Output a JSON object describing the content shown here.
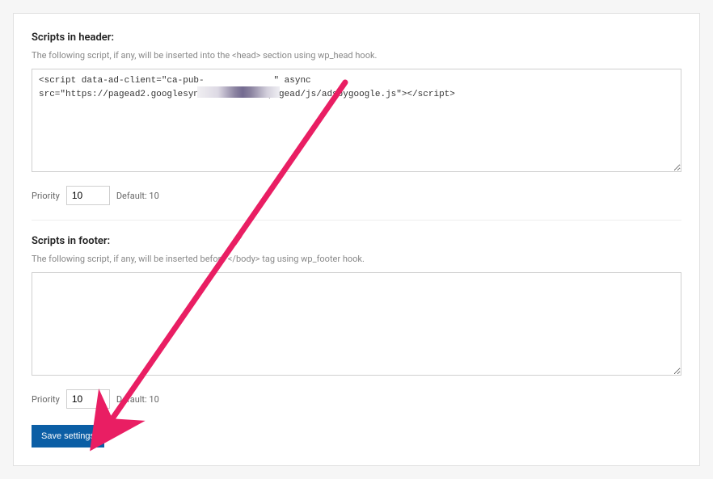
{
  "header": {
    "title": "Scripts in header:",
    "desc": "The following script, if any, will be inserted into the <head> section using wp_head hook.",
    "textarea_value": "<script data-ad-client=\"ca-pub-             \" async src=\"https://pagead2.googlesyndication.com/pagead/js/adsbygoogle.js\"></script>",
    "priority_label": "Priority",
    "priority_value": "10",
    "priority_default": "Default: 10"
  },
  "footer": {
    "title": "Scripts in footer:",
    "desc": "The following script, if any, will be inserted before </body> tag using wp_footer hook.",
    "textarea_value": "",
    "priority_label": "Priority",
    "priority_value": "10",
    "priority_default": "Default: 10"
  },
  "save_label": "Save settings"
}
